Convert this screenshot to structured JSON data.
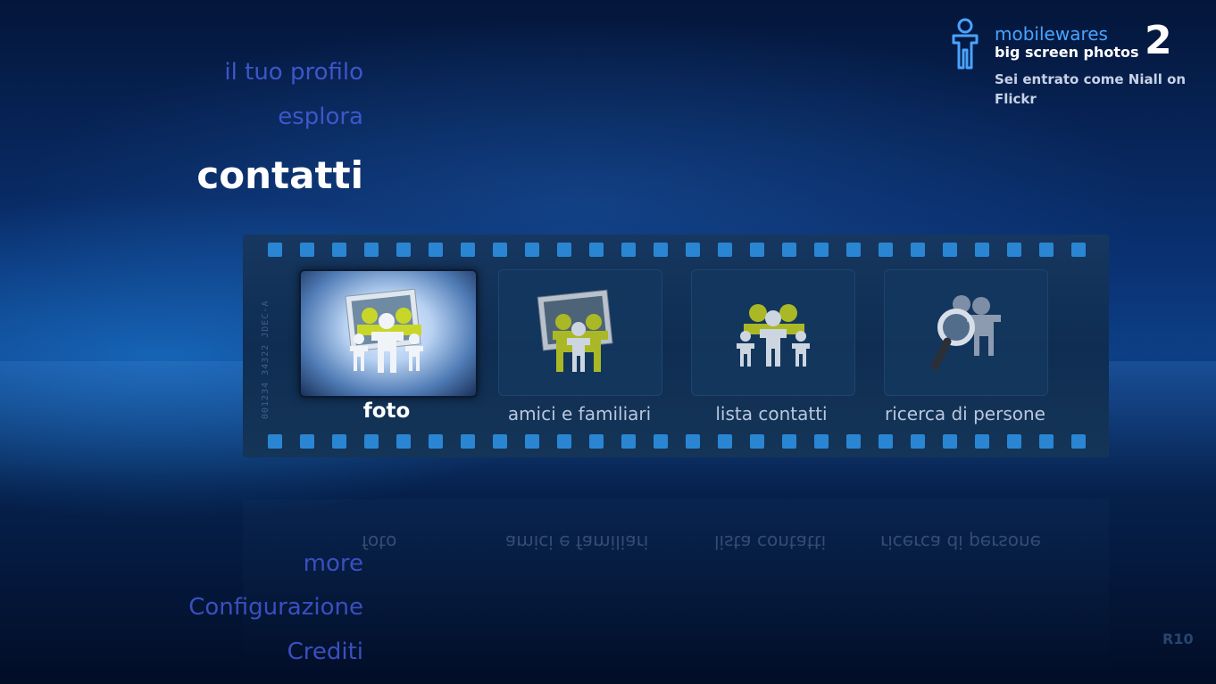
{
  "nav": {
    "profile": "il tuo profilo",
    "explore": "esplora",
    "contacts": "contatti",
    "more": "more",
    "settings": "Configurazione",
    "credits": "Crediti"
  },
  "brand": {
    "name": "mobilewares",
    "product": "big screen photos",
    "version_number": "2",
    "status": "Sei entrato come Niall on Flickr",
    "icon": "person-icon"
  },
  "filmstrip": {
    "edge_code": "001234  34322  JDEC-A",
    "items": [
      {
        "label": "foto",
        "icon": "people-photos-icon",
        "selected": true
      },
      {
        "label": "amici e familiari",
        "icon": "friends-family-icon",
        "selected": false
      },
      {
        "label": "lista contatti",
        "icon": "contacts-list-icon",
        "selected": false
      },
      {
        "label": "ricerca di persone",
        "icon": "people-search-icon",
        "selected": false
      }
    ]
  },
  "footer": {
    "revision": "R10"
  },
  "colors": {
    "accent": "#4aa3ff",
    "menu": "#3d56c9",
    "perforation": "#2a86d3",
    "people_yellow": "#c8d62a"
  }
}
